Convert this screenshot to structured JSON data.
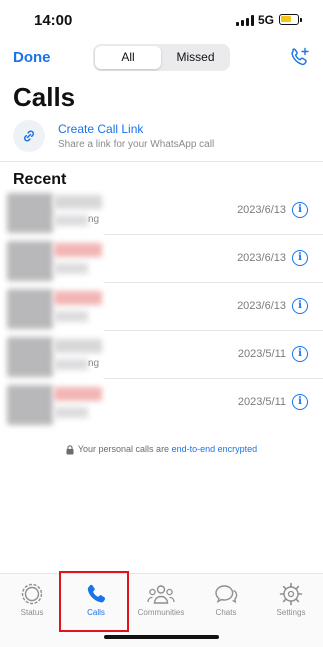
{
  "status_bar": {
    "time": "14:00",
    "network": "5G"
  },
  "header": {
    "done_label": "Done",
    "segments": [
      {
        "label": "All",
        "active": true
      },
      {
        "label": "Missed",
        "active": false
      }
    ],
    "new_call_icon": "phone-plus-icon"
  },
  "page_title": "Calls",
  "create_link": {
    "icon": "link-icon",
    "title": "Create Call Link",
    "subtitle": "Share a link for your WhatsApp call"
  },
  "recent": {
    "title": "Recent",
    "calls": [
      {
        "type_suffix": "ng",
        "date": "2023/6/13",
        "missed": false
      },
      {
        "type_suffix": "",
        "date": "2023/6/13",
        "missed": true
      },
      {
        "type_suffix": "",
        "date": "2023/6/13",
        "missed": true
      },
      {
        "type_suffix": "ng",
        "date": "2023/5/11",
        "missed": false
      },
      {
        "type_suffix": "",
        "date": "2023/5/11",
        "missed": true
      }
    ],
    "info_glyph": "i"
  },
  "encryption_note": {
    "text": "Your personal calls are ",
    "link": "end-to-end encrypted"
  },
  "tab_bar": {
    "tabs": [
      {
        "label": "Status",
        "icon": "status-icon",
        "active": false
      },
      {
        "label": "Calls",
        "icon": "phone-icon",
        "active": true
      },
      {
        "label": "Communities",
        "icon": "communities-icon",
        "active": false
      },
      {
        "label": "Chats",
        "icon": "chats-icon",
        "active": false
      },
      {
        "label": "Settings",
        "icon": "gear-icon",
        "active": false
      }
    ]
  },
  "colors": {
    "accent": "#1a73e8",
    "highlight": "#e3131b",
    "battery": "#f5c518"
  }
}
